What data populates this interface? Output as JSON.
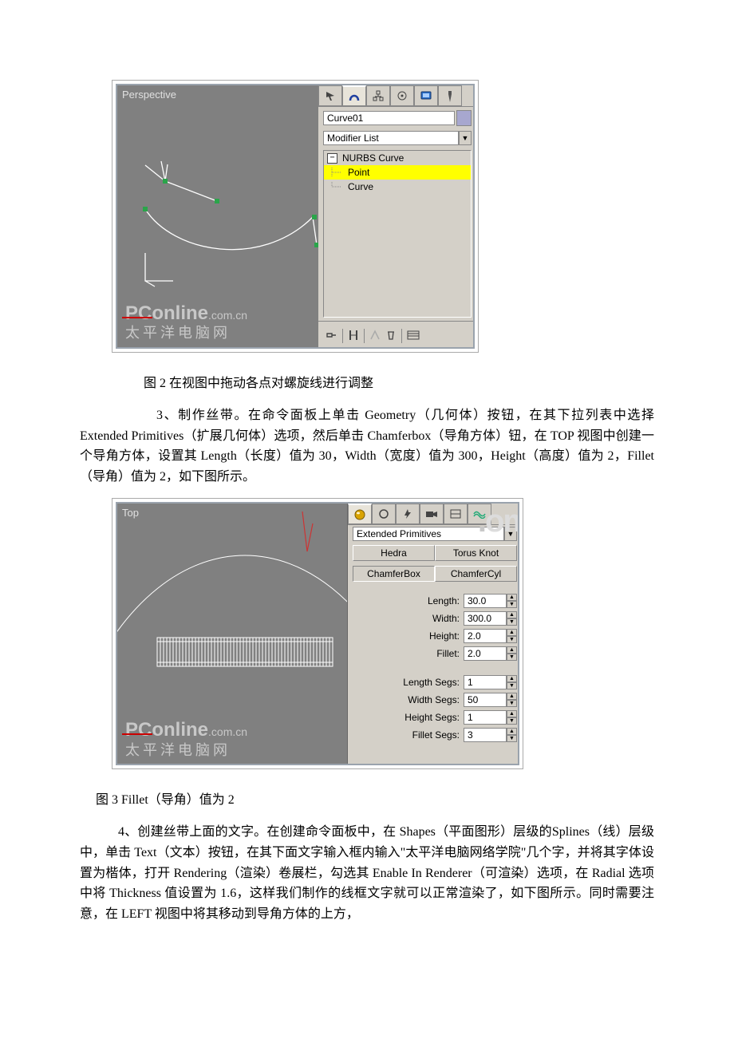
{
  "figure1": {
    "viewport_label": "Perspective",
    "object_name": "Curve01",
    "modifier_list": "Modifier List",
    "stack": {
      "root": "NURBS Curve",
      "child1": "Point",
      "child2": "Curve"
    },
    "watermark_l1a": "PConline",
    "watermark_l1b": ".com.cn",
    "watermark_l2": "太平洋电脑网"
  },
  "caption1": "图 2 在视图中拖动各点对螺旋线进行调整",
  "para1": "3、制作丝带。在命令面板上单击 Geometry（几何体）按钮，在其下拉列表中选择 Extended Primitives（扩展几何体）选项，然后单击 Chamferbox（导角方体）钮，在 TOP 视图中创建一个导角方体，设置其 Length（长度）值为 30，Width（宽度）值为 300，Height（高度）值为 2，Fillet（导角）值为 2，如下图所示。",
  "figure2": {
    "viewport_label": "Top",
    "dropdown": "Extended Primitives",
    "types": {
      "hedra": "Hedra",
      "torus": "Torus Knot",
      "chamfer": "ChamferBox",
      "chamcyl": "ChamferCyl"
    },
    "params": {
      "length_lbl": "Length:",
      "length_val": "30.0",
      "width_lbl": "Width:",
      "width_val": "300.0",
      "height_lbl": "Height:",
      "height_val": "2.0",
      "fillet_lbl": "Fillet:",
      "fillet_val": "2.0",
      "lseg_lbl": "Length Segs:",
      "lseg_val": "1",
      "wseg_lbl": "Width Segs:",
      "wseg_val": "50",
      "hseg_lbl": "Height Segs:",
      "hseg_val": "1",
      "fseg_lbl": "Fillet Segs:",
      "fseg_val": "3"
    },
    "watermark_l1a": "PConline",
    "watermark_l1b": ".com.cn",
    "watermark_l2": "太平洋电脑网",
    "big_wm": "om"
  },
  "caption2": "图 3 Fillet（导角）值为 2",
  "para2": "4、创建丝带上面的文字。在创建命令面板中，在 Shapes（平面图形）层级的Splines（线）层级中，单击 Text（文本）按钮，在其下面文字输入框内输入\"太平洋电脑网络学院\"几个字，并将其字体设置为楷体，打开 Rendering（渲染）卷展栏，勾选其 Enable In Renderer（可渲染）选项，在 Radial 选项中将 Thickness 值设置为 1.6，这样我们制作的线框文字就可以正常渲染了，如下图所示。同时需要注意，在 LEFT 视图中将其移动到导角方体的上方，"
}
